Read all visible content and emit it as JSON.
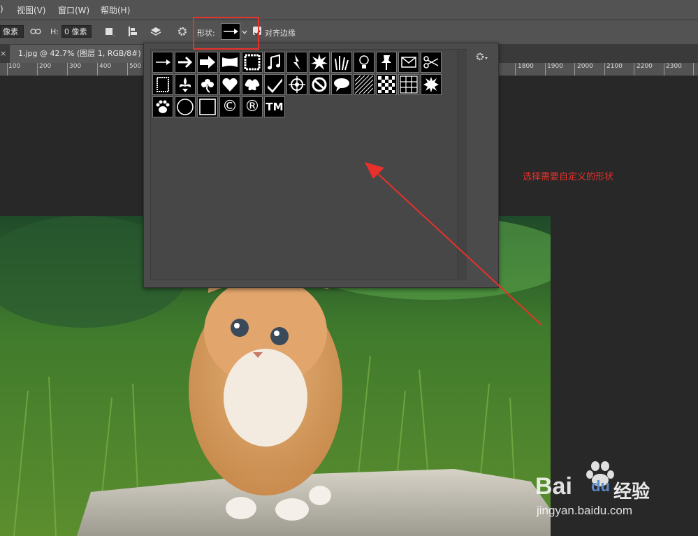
{
  "menubar": {
    "items": [
      ")",
      "视图(V)",
      "窗口(W)",
      "帮助(H)"
    ]
  },
  "options": {
    "width_value": "像素",
    "height_label": "H:",
    "height_value": "0 像素",
    "shape_label": "形状:",
    "align_edges_label": "对齐边缘"
  },
  "tab": {
    "title": "1.jpg @ 42.7% (图层 1, RGB/8#) *",
    "close_glyph": "×"
  },
  "ruler": {
    "labels_left": [
      "100",
      "200",
      "300",
      "400",
      "500"
    ],
    "labels_right": [
      "1800",
      "1900",
      "2000",
      "2100",
      "2200",
      "2300"
    ]
  },
  "shape_picker": {
    "rows": [
      [
        "arrow-thin",
        "arrow-medium",
        "arrow-bold",
        "banner",
        "frame-wavy",
        "music-notes",
        "lightning",
        "starburst",
        "grass",
        "lightbulb",
        "thumbtack",
        "envelope",
        "scissors"
      ],
      [
        "frame-stamp",
        "fleur-de-lis",
        "flower",
        "heart",
        "puzzle-splash",
        "checkmark",
        "target",
        "no-symbol",
        "speech-bubble",
        "diagonal-lines",
        "checkerboard",
        "grid",
        "starburst-2"
      ],
      [
        "paw-print",
        "circle",
        "square",
        "copyright",
        "registered",
        "trademark"
      ]
    ],
    "glyphs": {
      "copyright": "©",
      "registered": "®",
      "trademark": "TM"
    }
  },
  "annotation": {
    "text": "选择需要自定义的形状",
    "color": "#e8312b"
  },
  "watermark": {
    "brand": "Bai",
    "brand2": "du",
    "product": "经验",
    "url": "jingyan.baidu.com"
  }
}
